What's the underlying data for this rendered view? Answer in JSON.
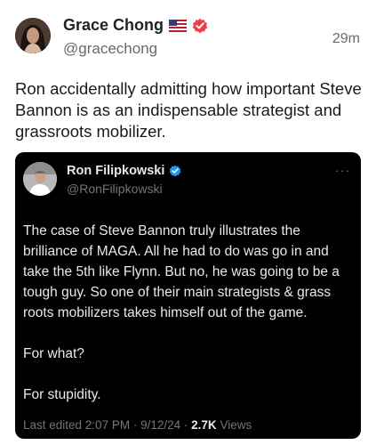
{
  "author": {
    "display_name": "Grace Chong",
    "handle": "@gracechong",
    "timestamp": "29m",
    "flag_icon": "us-flag-icon",
    "verified_icon": "verified-badge-icon",
    "verified_color": "#e8414b"
  },
  "post": {
    "text": "Ron accidentally admitting how important Steve Bannon is as an indispensable strategist and grassroots mobilizer."
  },
  "quoted": {
    "display_name": "Ron Filipkowski",
    "handle": "@RonFilipkowski",
    "verified_color": "#1d9bf0",
    "paragraphs": [
      "The case of Steve Bannon truly illustrates the brilliance of MAGA. All he had to do was go in and take the 5th like Flynn. But no, he was going to be a tough guy. So one of their main strategists & grass roots mobilizers takes himself out of the game.",
      "For what?",
      "For stupidity."
    ],
    "footer": {
      "edited": "Last edited 2:07 PM · 9/12/24 ·",
      "views_count": "2.7K",
      "views_label": "Views"
    },
    "more_icon": "more-horizontal-icon",
    "more_glyph": "···"
  }
}
